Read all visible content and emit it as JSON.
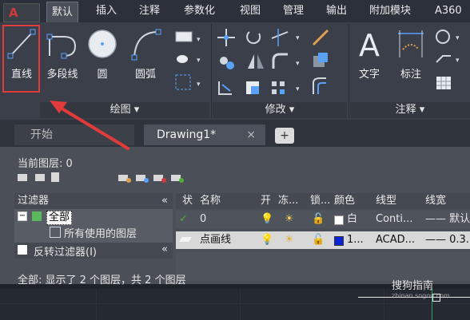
{
  "app": {
    "logo_letter": "A"
  },
  "ribbon_tabs": [
    "默认",
    "插入",
    "注释",
    "参数化",
    "视图",
    "管理",
    "输出",
    "附加模块",
    "A360"
  ],
  "draw_panel": {
    "buttons": [
      {
        "label": "直线"
      },
      {
        "label": "多段线"
      },
      {
        "label": "圆"
      },
      {
        "label": "圆弧"
      }
    ],
    "title": "绘图"
  },
  "modify_panel": {
    "title": "修改"
  },
  "annotate_panel": {
    "buttons": [
      {
        "label": "文字"
      },
      {
        "label": "标注"
      }
    ],
    "title": "注释"
  },
  "file_tabs": {
    "start": "开始",
    "drawing": "Drawing1*",
    "close": "×",
    "add": "+"
  },
  "layers": {
    "current_layer_label": "当前图层: 0",
    "filter_header": "过滤器",
    "tree_all": "全部",
    "tree_used": "所有使用的图层",
    "invert_filter": "反转过滤器(I)",
    "collapse_glyph": "«",
    "columns": [
      "状",
      "名称",
      "开",
      "冻...",
      "锁...",
      "颜色",
      "线型",
      "线宽"
    ],
    "rows": [
      {
        "name": "0",
        "color_name": "白",
        "color_hex": "#ffffff",
        "linetype": "Conti...",
        "lineweight": "—— 默认"
      },
      {
        "name": "点画线",
        "color_name": "1...",
        "color_hex": "#0a22d8",
        "linetype": "ACAD...",
        "lineweight": "—— 0.3..."
      }
    ],
    "status": "全部: 显示了 2 个图层，共 2 个图层"
  },
  "watermark": {
    "text": "搜狗指南",
    "sub": "zhinan.sogou.com"
  },
  "colors": {
    "highlight": "#e33a3a",
    "accent_check": "#4caf3a"
  }
}
